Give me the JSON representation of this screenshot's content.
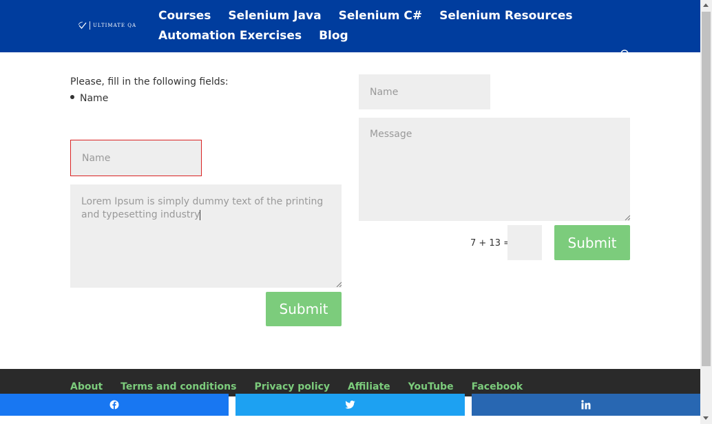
{
  "header": {
    "logo_text": "ULTIMATE QA",
    "nav": [
      [
        "Courses",
        "Selenium Java",
        "Selenium C#",
        "Selenium Resources"
      ],
      [
        "Automation Exercises",
        "Blog"
      ]
    ]
  },
  "left_form": {
    "intro": "Please, fill in the following fields:",
    "missing_fields": [
      "Name"
    ],
    "name_placeholder": "Name",
    "message_value": "Lorem Ipsum is simply dummy text of the printing and typesetting industry",
    "submit_label": "Submit"
  },
  "right_form": {
    "name_placeholder": "Name",
    "message_placeholder": "Message",
    "captcha_label": "7 + 13 =",
    "captcha_value": "",
    "submit_label": "Submit"
  },
  "footer": {
    "links": [
      "About",
      "Terms and conditions",
      "Privacy policy",
      "Affiliate",
      "YouTube",
      "Facebook"
    ]
  },
  "share_bar": [
    {
      "network": "facebook",
      "icon": "facebook-icon"
    },
    {
      "network": "twitter",
      "icon": "twitter-icon"
    },
    {
      "network": "linkedin",
      "icon": "linkedin-icon"
    }
  ],
  "colors": {
    "header_bg": "#003d9e",
    "submit_bg": "#7ccc7c",
    "error_border": "#d92121",
    "field_bg": "#eeeeee",
    "facebook": "#1877f2",
    "twitter": "#1da1f2",
    "linkedin": "#2867b2"
  }
}
